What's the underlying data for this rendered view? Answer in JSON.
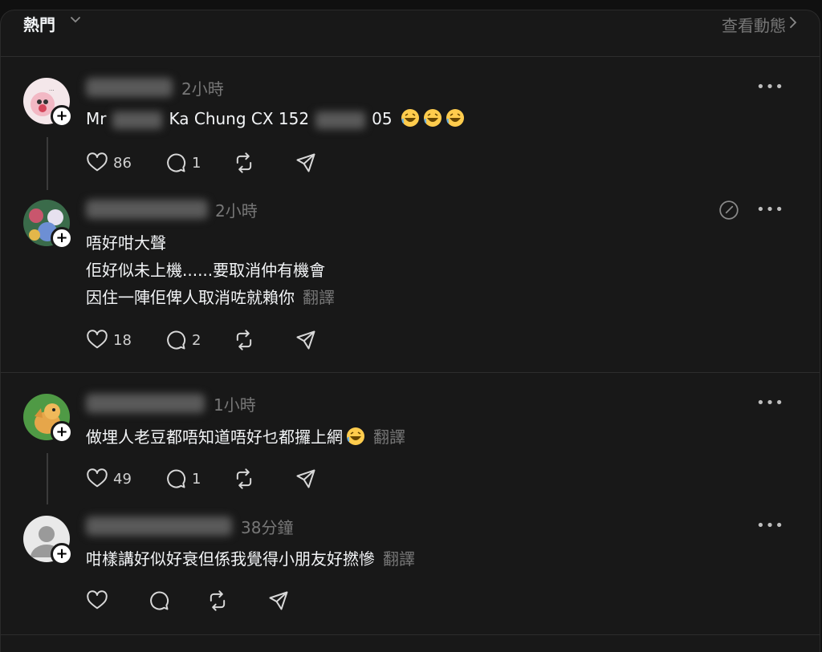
{
  "header": {
    "sort_label": "熱門",
    "activity_link": "查看動態"
  },
  "comments": [
    {
      "time": "2小時",
      "text_prefix": "Mr",
      "text_middle": "Ka Chung CX 152",
      "text_suffix": "05",
      "likes": "86",
      "replies": "1"
    },
    {
      "time": "2小時",
      "lines": [
        "唔好咁大聲",
        "佢好似未上機......要取消仲有機會",
        "因住一陣佢俾人取消咗就賴你"
      ],
      "translate": "翻譯",
      "likes": "18",
      "replies": "2"
    },
    {
      "time": "1小時",
      "text": "做埋人老豆都唔知道唔好乜都攞上網",
      "translate": "翻譯",
      "likes": "49",
      "replies": "1"
    },
    {
      "time": "38分鐘",
      "text": "咁樣講好似好衰但係我覺得小朋友好撚慘",
      "translate": "翻譯"
    }
  ],
  "icons": {
    "like": "heart-icon",
    "reply": "comment-bubble-icon",
    "repost": "repost-icon",
    "share": "send-icon",
    "more": "more-horizontal-icon",
    "follow": "plus-icon"
  },
  "colors": {
    "background": "#181818",
    "text": "#f3f5f7",
    "muted": "#777777"
  }
}
